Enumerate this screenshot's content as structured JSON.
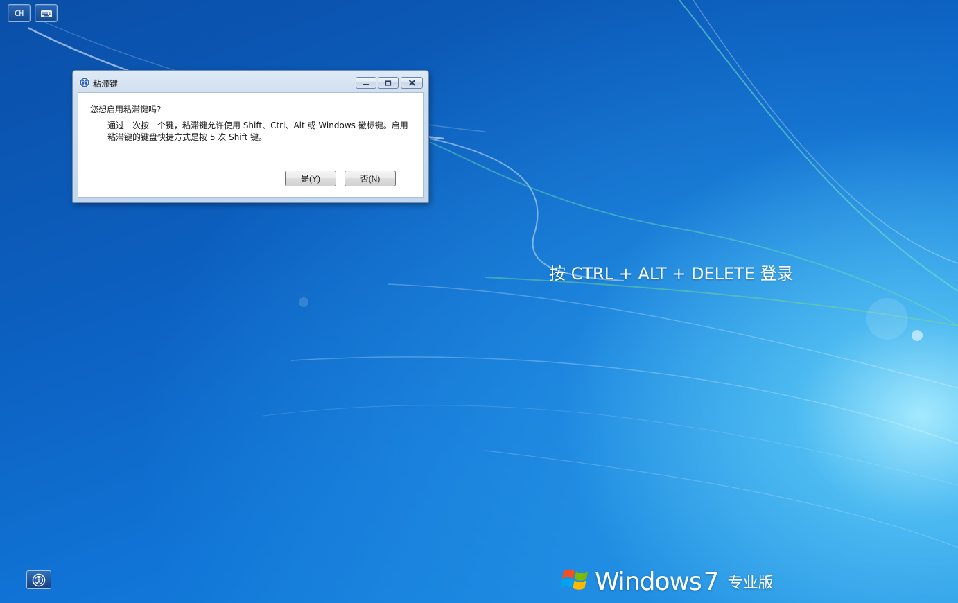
{
  "top_bar": {
    "language_label": "CH",
    "keyboard_icon": "keyboard-icon"
  },
  "dialog": {
    "title": "粘滞键",
    "title_icon": "ease-of-access-icon",
    "question": "您想启用粘滞键吗?",
    "description_line1": "通过一次按一个键，粘滞键允许使用 Shift、Ctrl、Alt 或 Windows 徽标键。启用",
    "description_line2": "粘滞键的键盘快捷方式是按 5 次 Shift 键。",
    "yes_label": "是(Y)",
    "no_label": "否(N)"
  },
  "login_prompt": "按 CTRL + ALT + DELETE 登录",
  "branding": {
    "name": "Windows",
    "version": "7",
    "edition": "专业版"
  },
  "ease_of_access": {
    "icon": "ease-of-access-icon"
  },
  "colors": {
    "desktop_dark": "#0a4fa8",
    "desktop_light": "#aaeeff",
    "dialog_frame": "#c5d7ec"
  }
}
